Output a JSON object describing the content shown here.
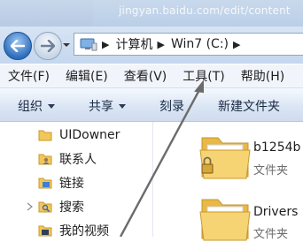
{
  "browser": {
    "url_fragment": "jingyan.baidu.com/edit/content"
  },
  "navigation": {
    "breadcrumbs": [
      "计算机",
      "Win7 (C:)"
    ]
  },
  "menubar": {
    "items": [
      "文件(F)",
      "编辑(E)",
      "查看(V)",
      "工具(T)",
      "帮助(H)"
    ]
  },
  "commandbar": {
    "organize": "组织",
    "share": "共享",
    "burn": "刻录",
    "new_folder": "新建文件夹"
  },
  "navpane": {
    "items": [
      {
        "label": "UIDowner",
        "icon": "folder-icon"
      },
      {
        "label": "联系人",
        "icon": "contacts-icon"
      },
      {
        "label": "链接",
        "icon": "links-icon"
      },
      {
        "label": "搜索",
        "icon": "search-folder-icon"
      },
      {
        "label": "我的视频",
        "icon": "videos-icon"
      }
    ]
  },
  "files": [
    {
      "name": "b1254b",
      "type": "文件夹",
      "locked": true
    },
    {
      "name": "Drivers",
      "type": "文件夹",
      "locked": false
    }
  ],
  "colors": {
    "accent": "#2d6fbd",
    "folder": "#f2c75a",
    "arrow": "#6b6b6b"
  }
}
